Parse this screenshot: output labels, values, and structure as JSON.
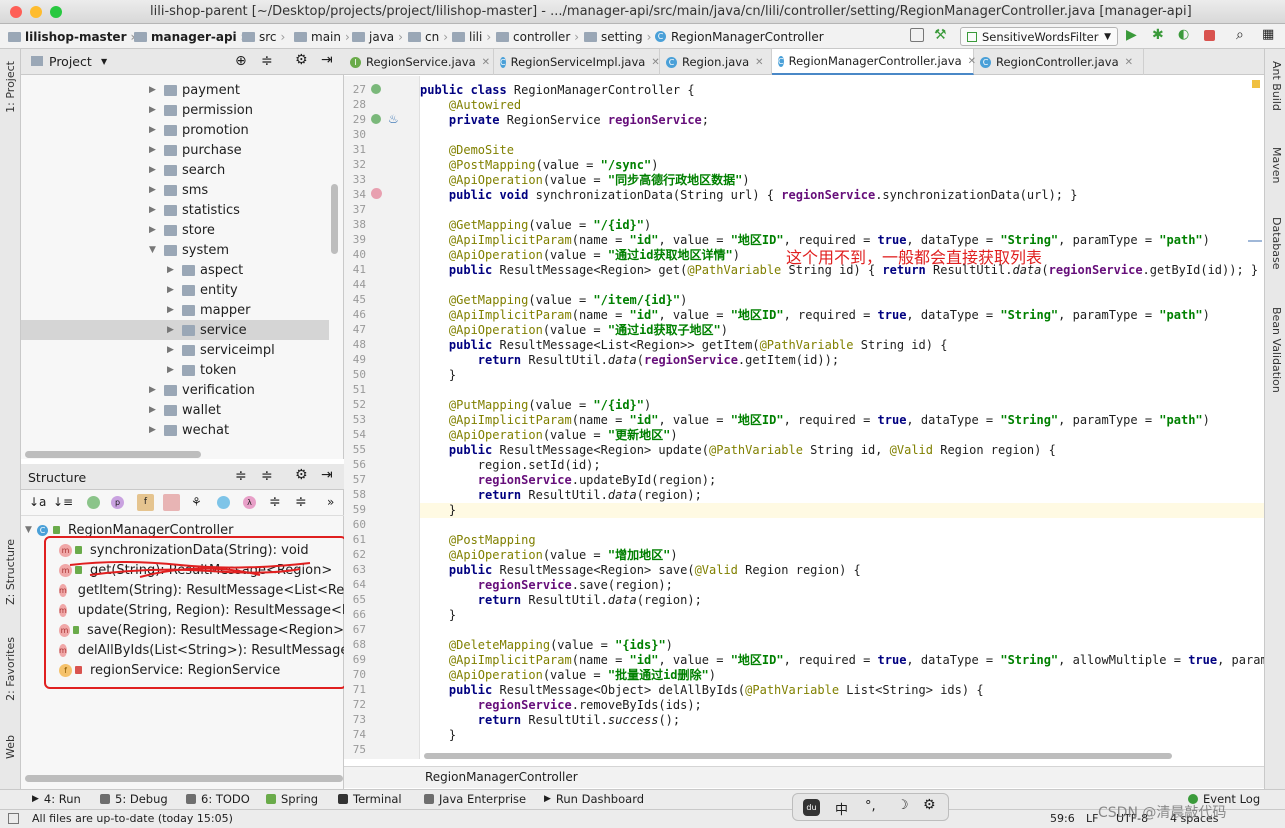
{
  "window": {
    "title": "lili-shop-parent [~/Desktop/projects/project/lilishop-master] - .../manager-api/src/main/java/cn/lili/controller/setting/RegionManagerController.java [manager-api]"
  },
  "navbar": {
    "crumbs": [
      "lilishop-master",
      "manager-api",
      "src",
      "main",
      "java",
      "cn",
      "lili",
      "controller",
      "setting",
      "RegionManagerController"
    ],
    "run_config": "SensitiveWordsFilter"
  },
  "editor_tabs": [
    {
      "label": "RegionService.java",
      "icon": "interface-icon",
      "color": "#6aab4a"
    },
    {
      "label": "RegionServiceImpl.java",
      "icon": "class-icon",
      "color": "#4aa0d8"
    },
    {
      "label": "Region.java",
      "icon": "class-icon",
      "color": "#4aa0d8"
    },
    {
      "label": "RegionManagerController.java",
      "icon": "class-icon",
      "color": "#4aa0d8",
      "active": true
    },
    {
      "label": "RegionController.java",
      "icon": "class-icon",
      "color": "#4aa0d8"
    }
  ],
  "project_panel": {
    "title": "Project",
    "tree": [
      {
        "label": "payment",
        "depth": 0,
        "expanded": false
      },
      {
        "label": "permission",
        "depth": 0,
        "expanded": false
      },
      {
        "label": "promotion",
        "depth": 0,
        "expanded": false
      },
      {
        "label": "purchase",
        "depth": 0,
        "expanded": false
      },
      {
        "label": "search",
        "depth": 0,
        "expanded": false
      },
      {
        "label": "sms",
        "depth": 0,
        "expanded": false
      },
      {
        "label": "statistics",
        "depth": 0,
        "expanded": false
      },
      {
        "label": "store",
        "depth": 0,
        "expanded": false
      },
      {
        "label": "system",
        "depth": 0,
        "expanded": true
      },
      {
        "label": "aspect",
        "depth": 1,
        "expanded": false
      },
      {
        "label": "entity",
        "depth": 1,
        "expanded": false
      },
      {
        "label": "mapper",
        "depth": 1,
        "expanded": false
      },
      {
        "label": "service",
        "depth": 1,
        "expanded": false,
        "selected": true
      },
      {
        "label": "serviceimpl",
        "depth": 1,
        "expanded": false
      },
      {
        "label": "token",
        "depth": 1,
        "expanded": false
      },
      {
        "label": "verification",
        "depth": 0,
        "expanded": false
      },
      {
        "label": "wallet",
        "depth": 0,
        "expanded": false
      },
      {
        "label": "wechat",
        "depth": 0,
        "expanded": false
      }
    ]
  },
  "structure_panel": {
    "title": "Structure",
    "root": "RegionManagerController",
    "members": [
      {
        "kind": "m",
        "label": "synchronizationData(String): void"
      },
      {
        "kind": "m",
        "label": "get(String): ResultMessage<Region>"
      },
      {
        "kind": "m",
        "label": "getItem(String): ResultMessage<List<Region>>"
      },
      {
        "kind": "m",
        "label": "update(String, Region): ResultMessage<Region>"
      },
      {
        "kind": "m",
        "label": "save(Region): ResultMessage<Region>"
      },
      {
        "kind": "m",
        "label": "delAllByIds(List<String>): ResultMessage<Object>"
      },
      {
        "kind": "f",
        "label": "regionService: RegionService"
      }
    ]
  },
  "code": {
    "current_line": 59,
    "lines": [
      {
        "n": "27",
        "html": "<span class=\"kw\">public class</span> RegionManagerController {"
      },
      {
        "n": "28",
        "html": "    <span class=\"ann\">@Autowired</span>"
      },
      {
        "n": "29",
        "html": "    <span class=\"kw\">private</span> RegionService <span class=\"fld\">regionService</span>;"
      },
      {
        "n": "30",
        "html": ""
      },
      {
        "n": "31",
        "html": "    <span class=\"ann\">@DemoSite</span>"
      },
      {
        "n": "32",
        "html": "    <span class=\"ann\">@PostMapping</span>(value = <span class=\"str\">\"/sync\"</span>)"
      },
      {
        "n": "33",
        "html": "    <span class=\"ann\">@ApiOperation</span>(value = <span class=\"str\">\"同步高德行政地区数据\"</span>)"
      },
      {
        "n": "34",
        "html": "    <span class=\"kw\">public void</span> synchronizationData(String url) { <span class=\"fld\">regionService</span>.synchronizationData(url); }"
      },
      {
        "n": "37",
        "html": ""
      },
      {
        "n": "38",
        "html": "    <span class=\"ann\">@GetMapping</span>(value = <span class=\"str\">\"/{id}\"</span>)"
      },
      {
        "n": "39",
        "html": "    <span class=\"ann\">@ApiImplicitParam</span>(name = <span class=\"str\">\"id\"</span>, value = <span class=\"str\">\"地区ID\"</span>, required = <span class=\"kw\">true</span>, dataType = <span class=\"str\">\"String\"</span>, paramType = <span class=\"str\">\"path\"</span>)"
      },
      {
        "n": "40",
        "html": "    <span class=\"ann\">@ApiOperation</span>(value = <span class=\"str\">\"通过id获取地区详情\"</span>)"
      },
      {
        "n": "41",
        "html": "    <span class=\"kw\">public</span> ResultMessage&lt;Region&gt; get(<span class=\"ann\">@PathVariable</span> String id) { <span class=\"kw\">return</span> ResultUtil.<span class=\"it\">data</span>(<span class=\"fld\">regionService</span>.getById(id)); }"
      },
      {
        "n": "44",
        "html": ""
      },
      {
        "n": "45",
        "html": "    <span class=\"ann\">@GetMapping</span>(value = <span class=\"str\">\"/item/{id}\"</span>)"
      },
      {
        "n": "46",
        "html": "    <span class=\"ann\">@ApiImplicitParam</span>(name = <span class=\"str\">\"id\"</span>, value = <span class=\"str\">\"地区ID\"</span>, required = <span class=\"kw\">true</span>, dataType = <span class=\"str\">\"String\"</span>, paramType = <span class=\"str\">\"path\"</span>)"
      },
      {
        "n": "47",
        "html": "    <span class=\"ann\">@ApiOperation</span>(value = <span class=\"str\">\"通过id获取子地区\"</span>)"
      },
      {
        "n": "48",
        "html": "    <span class=\"kw\">public</span> ResultMessage&lt;List&lt;Region&gt;&gt; getItem(<span class=\"ann\">@PathVariable</span> String id) {"
      },
      {
        "n": "49",
        "html": "        <span class=\"kw\">return</span> ResultUtil.<span class=\"it\">data</span>(<span class=\"fld\">regionService</span>.getItem(id));"
      },
      {
        "n": "50",
        "html": "    }"
      },
      {
        "n": "51",
        "html": ""
      },
      {
        "n": "52",
        "html": "    <span class=\"ann\">@PutMapping</span>(value = <span class=\"str\">\"/{id}\"</span>)"
      },
      {
        "n": "53",
        "html": "    <span class=\"ann\">@ApiImplicitParam</span>(name = <span class=\"str\">\"id\"</span>, value = <span class=\"str\">\"地区ID\"</span>, required = <span class=\"kw\">true</span>, dataType = <span class=\"str\">\"String\"</span>, paramType = <span class=\"str\">\"path\"</span>)"
      },
      {
        "n": "54",
        "html": "    <span class=\"ann\">@ApiOperation</span>(value = <span class=\"str\">\"更新地区\"</span>)"
      },
      {
        "n": "55",
        "html": "    <span class=\"kw\">public</span> ResultMessage&lt;Region&gt; update(<span class=\"ann\">@PathVariable</span> String id, <span class=\"ann\">@Valid</span> Region region) {"
      },
      {
        "n": "56",
        "html": "        region.setId(id);"
      },
      {
        "n": "57",
        "html": "        <span class=\"fld\">regionService</span>.updateById(region);"
      },
      {
        "n": "58",
        "html": "        <span class=\"kw\">return</span> ResultUtil.<span class=\"it\">data</span>(region);"
      },
      {
        "n": "59",
        "html": "    }"
      },
      {
        "n": "60",
        "html": ""
      },
      {
        "n": "61",
        "html": "    <span class=\"ann\">@PostMapping</span>"
      },
      {
        "n": "62",
        "html": "    <span class=\"ann\">@ApiOperation</span>(value = <span class=\"str\">\"增加地区\"</span>)"
      },
      {
        "n": "63",
        "html": "    <span class=\"kw\">public</span> ResultMessage&lt;Region&gt; save(<span class=\"ann\">@Valid</span> Region region) {"
      },
      {
        "n": "64",
        "html": "        <span class=\"fld\">regionService</span>.save(region);"
      },
      {
        "n": "65",
        "html": "        <span class=\"kw\">return</span> ResultUtil.<span class=\"it\">data</span>(region);"
      },
      {
        "n": "66",
        "html": "    }"
      },
      {
        "n": "67",
        "html": ""
      },
      {
        "n": "68",
        "html": "    <span class=\"ann\">@DeleteMapping</span>(value = <span class=\"str\">\"{ids}\"</span>)"
      },
      {
        "n": "69",
        "html": "    <span class=\"ann\">@ApiImplicitParam</span>(name = <span class=\"str\">\"id\"</span>, value = <span class=\"str\">\"地区ID\"</span>, required = <span class=\"kw\">true</span>, dataType = <span class=\"str\">\"String\"</span>, allowMultiple = <span class=\"kw\">true</span>, paramTyp"
      },
      {
        "n": "70",
        "html": "    <span class=\"ann\">@ApiOperation</span>(value = <span class=\"str\">\"批量通过id删除\"</span>)"
      },
      {
        "n": "71",
        "html": "    <span class=\"kw\">public</span> ResultMessage&lt;Object&gt; delAllByIds(<span class=\"ann\">@PathVariable</span> List&lt;String&gt; ids) {"
      },
      {
        "n": "72",
        "html": "        <span class=\"fld\">regionService</span>.removeByIds(ids);"
      },
      {
        "n": "73",
        "html": "        <span class=\"kw\">return</span> ResultUtil.<span class=\"it\">success</span>();"
      },
      {
        "n": "74",
        "html": "    }"
      },
      {
        "n": "75",
        "html": ""
      }
    ]
  },
  "annotation_note": "这个用不到，一般都会直接获取列表",
  "editor_breadcrumb": "RegionManagerController",
  "tool_windows": [
    {
      "label": "4: Run"
    },
    {
      "label": "5: Debug"
    },
    {
      "label": "6: TODO"
    },
    {
      "label": "Spring"
    },
    {
      "label": "Terminal"
    },
    {
      "label": "Java Enterprise"
    },
    {
      "label": "Run Dashboard"
    },
    {
      "label": "Event Log"
    }
  ],
  "side_tabs": {
    "left": [
      "1: Project",
      "Z: Structure",
      "2: Favorites",
      "Web"
    ],
    "right": [
      "Ant Build",
      "Maven",
      "Database",
      "Bean Validation"
    ]
  },
  "status": {
    "message": "All files are up-to-date (today 15:05)",
    "position": "59:6",
    "line_sep": "LF",
    "encoding": "UTF-8",
    "indent": "4 spaces",
    "watermark": "CSDN @清晨敲代码"
  },
  "ime": {
    "lang": "中",
    "punct": "°,"
  }
}
